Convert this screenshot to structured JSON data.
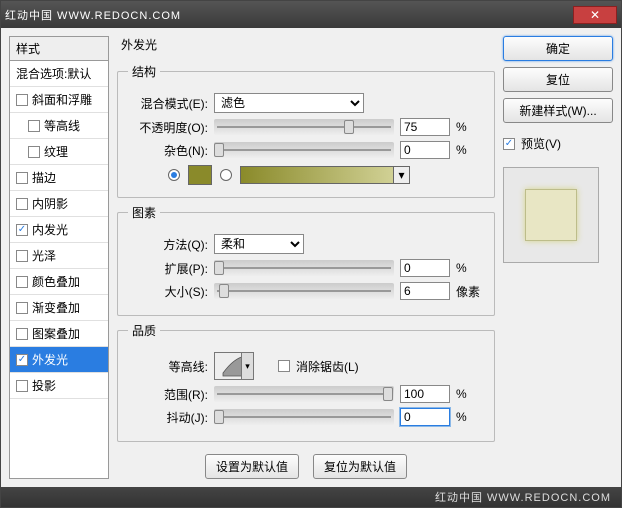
{
  "title": "红动中国 WWW.REDOCN.COM",
  "footer": "红动中国 WWW.REDOCN.COM",
  "close_x": "✕",
  "left": {
    "header": "样式",
    "blendopt": "混合选项:默认",
    "items": [
      {
        "label": "斜面和浮雕",
        "checked": false,
        "indent": false
      },
      {
        "label": "等高线",
        "checked": false,
        "indent": true
      },
      {
        "label": "纹理",
        "checked": false,
        "indent": true
      },
      {
        "label": "描边",
        "checked": false,
        "indent": false
      },
      {
        "label": "内阴影",
        "checked": false,
        "indent": false
      },
      {
        "label": "内发光",
        "checked": true,
        "indent": false
      },
      {
        "label": "光泽",
        "checked": false,
        "indent": false
      },
      {
        "label": "颜色叠加",
        "checked": false,
        "indent": false
      },
      {
        "label": "渐变叠加",
        "checked": false,
        "indent": false
      },
      {
        "label": "图案叠加",
        "checked": false,
        "indent": false
      },
      {
        "label": "外发光",
        "checked": true,
        "indent": false,
        "selected": true
      },
      {
        "label": "投影",
        "checked": false,
        "indent": false
      }
    ]
  },
  "mid": {
    "title": "外发光",
    "struct": {
      "legend": "结构",
      "blend_label": "混合模式(E):",
      "blend_value": "滤色",
      "opacity_label": "不透明度(O):",
      "opacity_value": "75",
      "noise_label": "杂色(N):",
      "noise_value": "0",
      "percent": "%"
    },
    "elem": {
      "legend": "图素",
      "method_label": "方法(Q):",
      "method_value": "柔和",
      "spread_label": "扩展(P):",
      "spread_value": "0",
      "size_label": "大小(S):",
      "size_value": "6",
      "px": "像素",
      "percent": "%"
    },
    "qual": {
      "legend": "品质",
      "contour_label": "等高线:",
      "aa_label": "消除锯齿(L)",
      "range_label": "范围(R):",
      "range_value": "100",
      "jitter_label": "抖动(J):",
      "jitter_value": "0",
      "percent": "%"
    },
    "btn_default": "设置为默认值",
    "btn_reset": "复位为默认值"
  },
  "right": {
    "ok": "确定",
    "cancel": "复位",
    "newstyle": "新建样式(W)...",
    "preview_label": "预览(V)"
  }
}
